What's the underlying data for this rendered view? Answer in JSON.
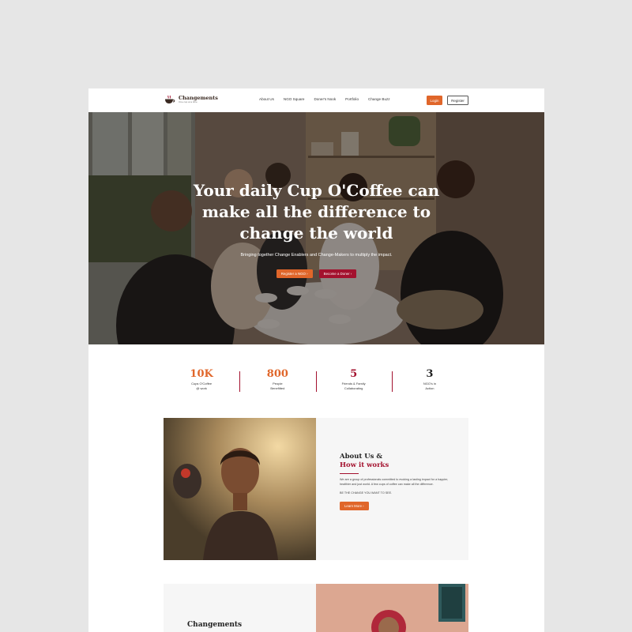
{
  "header": {
    "logo_name": "Changements",
    "logo_tagline": "One cup at a time",
    "nav": [
      "About Us",
      "NGO Square",
      "Doner's Nook",
      "Portfolio",
      "Change Buzz"
    ],
    "login_label": "Login",
    "register_label": "Register"
  },
  "hero": {
    "title_line1": "Your daily Cup O'Coffee can",
    "title_line2": "make all the difference to",
    "title_line3": "change the world",
    "subtitle": "Bringing together Change Enablers and Change-Makers to multiply the impact.",
    "btn_ngo": "Register a NGO  ›",
    "btn_donor": "Become a Doner  ›"
  },
  "stats": [
    {
      "value": "10K",
      "label": "Cups O'Coffee\n@ work",
      "color": "#e0662a"
    },
    {
      "value": "800",
      "label": "People\nBenefitted",
      "color": "#e0662a"
    },
    {
      "value": "5",
      "label": "Friends & Family\nCollaborating",
      "color": "#a3112e"
    },
    {
      "value": "3",
      "label": "NGO's in\nAction",
      "color": "#222222"
    }
  ],
  "about": {
    "heading1": "About Us &",
    "heading2": "How it works",
    "paragraph": "We are a group of professionals committed to evoking a lasting impact for a happier, healthier and just world. A few cups of coffee can make all the difference.",
    "tagline": "BE THE CHANGE YOU WANT TO SEE.",
    "button": "Learn More  ›"
  },
  "changements": {
    "title": "Changements"
  },
  "colors": {
    "accent_orange": "#e0662a",
    "accent_red": "#a3112e",
    "page_bg": "#e6e6e6"
  }
}
